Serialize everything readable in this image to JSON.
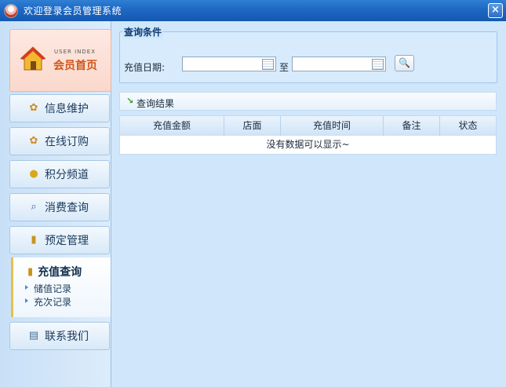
{
  "window": {
    "title": "欢迎登录会员管理系统"
  },
  "sidebar": {
    "home": {
      "en": "USER INDEX",
      "cn": "会员首页"
    },
    "items": [
      {
        "label": "信息维护",
        "icon": "gear-icon"
      },
      {
        "label": "在线订购",
        "icon": "gear-icon"
      },
      {
        "label": "积分频道",
        "icon": "coins-icon"
      },
      {
        "label": "消费查询",
        "icon": "magnifier-icon"
      },
      {
        "label": "预定管理",
        "icon": "medal-icon"
      }
    ],
    "active": {
      "label": "充值查询",
      "icon": "medal-icon",
      "subs": [
        "储值记录",
        "充次记录"
      ]
    },
    "contact": {
      "label": "联系我们",
      "icon": "card-icon"
    }
  },
  "query": {
    "legend": "查询条件",
    "date_label": "充值日期:",
    "to_label": "至",
    "start_value": "",
    "end_value": ""
  },
  "result": {
    "title": "查询结果",
    "columns": [
      "充值金额",
      "店面",
      "充值时间",
      "备注",
      "状态"
    ],
    "empty_text": "没有数据可以显示~"
  }
}
